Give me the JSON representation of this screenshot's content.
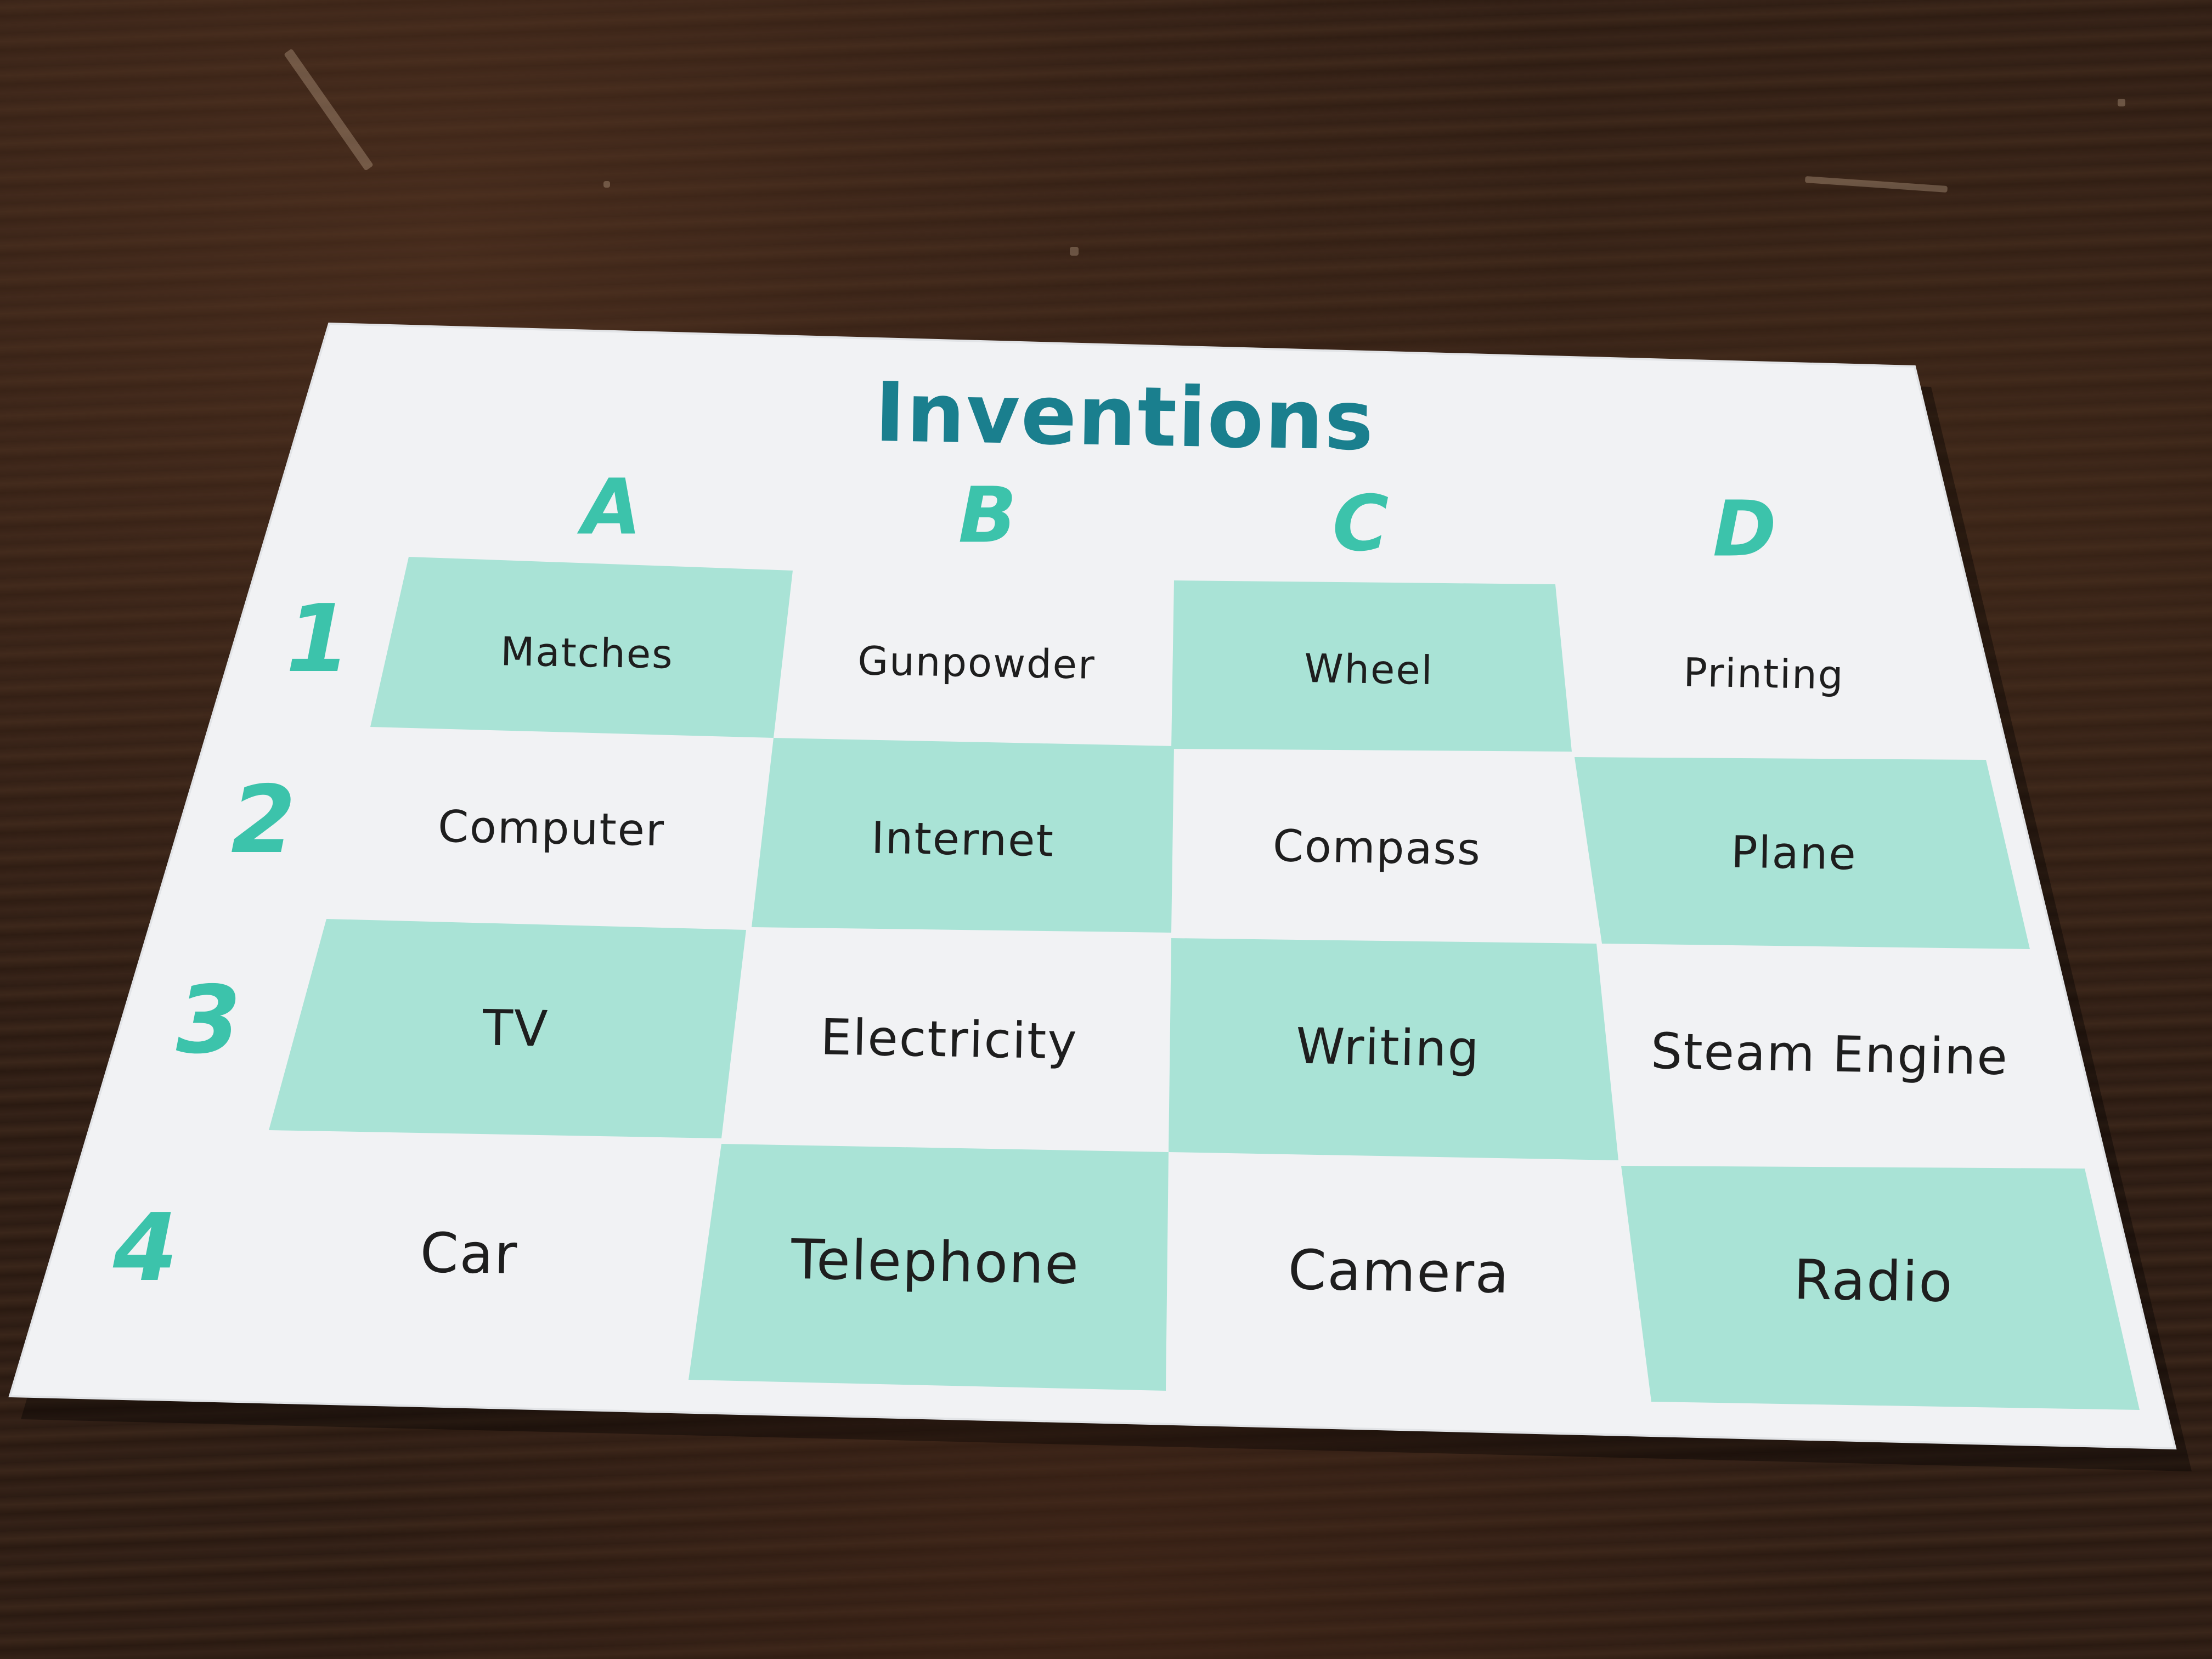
{
  "card": {
    "title": "Inventions",
    "columns": [
      "A",
      "B",
      "C",
      "D"
    ],
    "rows": [
      "1",
      "2",
      "3",
      "4"
    ],
    "cells": [
      [
        "Matches",
        "Gunpowder",
        "Wheel",
        "Printing"
      ],
      [
        "Computer",
        "Internet",
        "Compass",
        "Plane"
      ],
      [
        "TV",
        "Electricity",
        "Writing",
        "Steam Engine"
      ],
      [
        "Car",
        "Telephone",
        "Camera",
        "Radio"
      ]
    ],
    "colors": {
      "title": "#1a7f8e",
      "labels": "#3cc3ab",
      "shaded_cell": "#a9e3d6",
      "card_background": "#f1f2f4",
      "table_surface": "#2e1e15"
    }
  }
}
